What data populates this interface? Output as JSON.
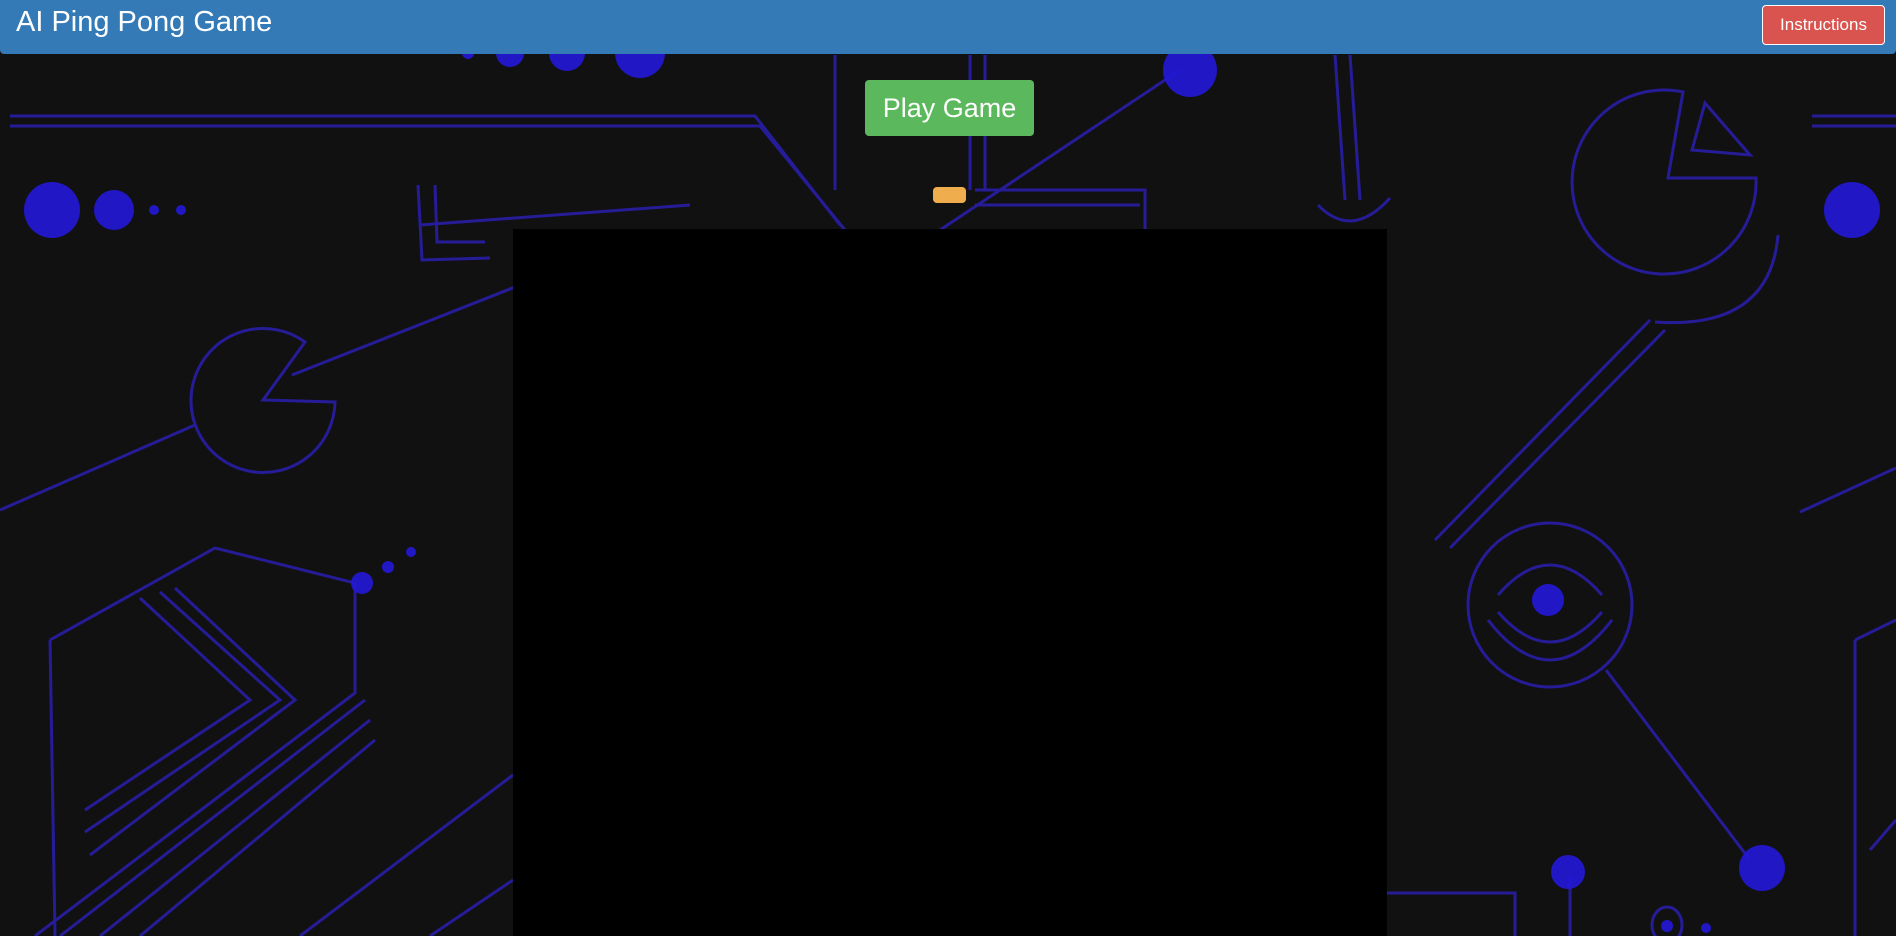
{
  "header": {
    "title": "AI Ping Pong Game",
    "instructions_label": "Instructions"
  },
  "main": {
    "play_label": "Play Game"
  },
  "colors": {
    "navbar": "#337ab7",
    "instructions_button": "#d9534f",
    "play_button": "#5cb85c",
    "paddle": "#f0ad4e",
    "canvas": "#000000",
    "background": "#111111",
    "background_art": "#2a1fd6"
  }
}
